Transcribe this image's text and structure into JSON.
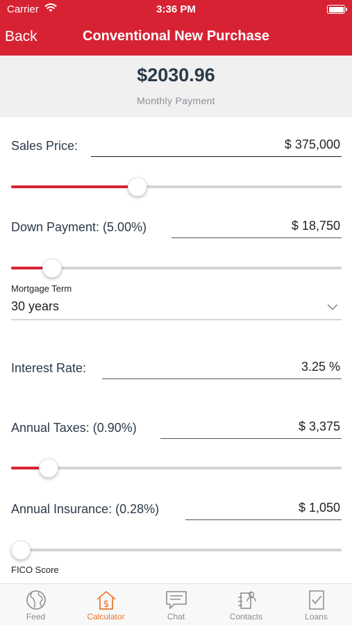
{
  "status_bar": {
    "carrier": "Carrier",
    "time": "3:36 PM"
  },
  "nav": {
    "back": "Back",
    "title": "Conventional New Purchase"
  },
  "payment": {
    "amount": "$2030.96",
    "caption": "Monthly Payment"
  },
  "fields": {
    "sales_price": {
      "label": "Sales Price:",
      "value": "$ 375,000",
      "slider_fraction": 0.375
    },
    "down_payment": {
      "label": "Down Payment: (5.00%)",
      "value": "$ 18,750",
      "slider_fraction": 0.1
    },
    "mortgage_term": {
      "label": "Mortgage Term",
      "value": "30 years"
    },
    "interest_rate": {
      "label": "Interest Rate:",
      "value": "3.25 %"
    },
    "annual_taxes": {
      "label": "Annual Taxes: (0.90%)",
      "value": "$ 3,375",
      "slider_fraction": 0.09
    },
    "annual_insurance": {
      "label": "Annual Insurance: (0.28%)",
      "value": "$ 1,050",
      "slider_fraction": 0.0
    },
    "fico_score": {
      "label": "FICO Score"
    }
  },
  "tabs": [
    {
      "label": "Feed",
      "icon": "globe-icon",
      "active": false
    },
    {
      "label": "Calculator",
      "icon": "house-dollar-icon",
      "active": true
    },
    {
      "label": "Chat",
      "icon": "chat-icon",
      "active": false
    },
    {
      "label": "Contacts",
      "icon": "contacts-icon",
      "active": false
    },
    {
      "label": "Loans",
      "icon": "loan-document-icon",
      "active": false
    }
  ],
  "colors": {
    "brand_red": "#d72234",
    "active_tab": "#e8752a",
    "inactive_tab": "#8a8a8a",
    "text_dark": "#2b3a4a"
  }
}
